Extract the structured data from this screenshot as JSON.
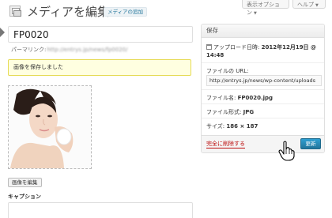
{
  "top_bar": {
    "screen_options": "表示オプション",
    "help": "ヘルプ"
  },
  "header": {
    "title": "メディアを編集",
    "add_media": "メディアの追加"
  },
  "editor": {
    "title_value": "FP0020",
    "permalink_label": "パーマリンク:",
    "permalink_url": "http://entrys.jp/news/fp0020/",
    "notice": "画像を保存しました",
    "edit_image_button": "画像を編集",
    "caption_label": "キャプション"
  },
  "save_box": {
    "heading": "保存",
    "upload_date_label": "アップロード日時:",
    "upload_date_value": "2012年12月19日 @ 14:48",
    "file_url_label": "ファイルの URL:",
    "file_url_value": "http://entrys.jp/news/wp-content/uploads",
    "file_name_label": "ファイル名:",
    "file_name_value": "FP0020.jpg",
    "file_type_label": "ファイル形式:",
    "file_type_value": "JPG",
    "dimensions_label": "サイズ:",
    "dimensions_value": "186 × 187",
    "delete_link": "完全に削除する",
    "update_button": "更新"
  },
  "colors": {
    "accent": "#21759b",
    "delete": "#bc0b0b",
    "notice_bg": "#ffffe0"
  },
  "icons": [
    "media-page-icon",
    "calendar-icon",
    "hand-cursor-icon"
  ]
}
